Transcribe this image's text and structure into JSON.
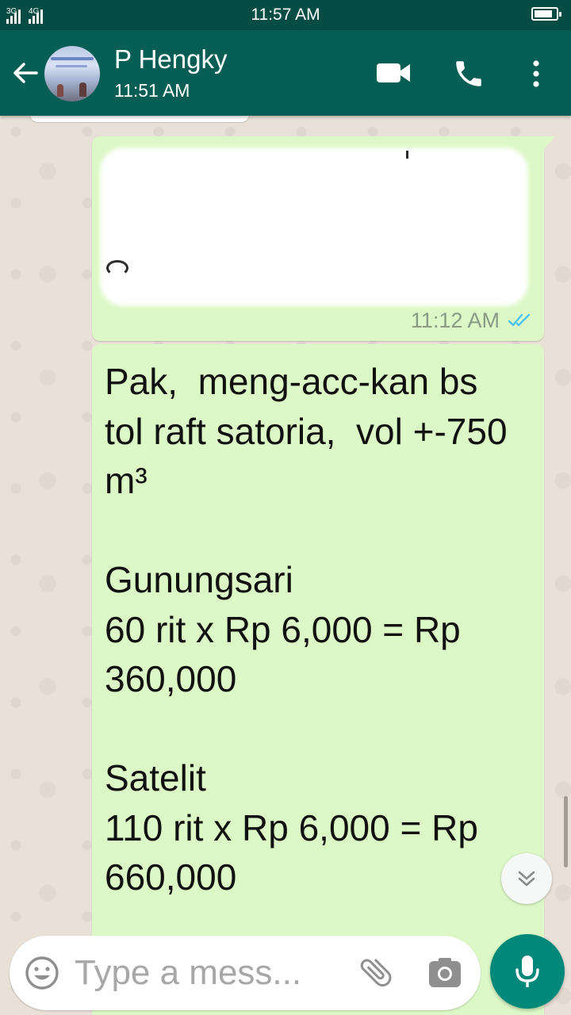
{
  "status_bar": {
    "network_labels": [
      "3G",
      "4G"
    ],
    "time": "11:57 AM",
    "battery_level": 0.85
  },
  "header": {
    "contact_name": "P Hengky",
    "last_seen": "11:51 AM"
  },
  "messages": [
    {
      "direction": "outgoing",
      "content_redacted": true,
      "time": "11:12 AM",
      "status": "read"
    },
    {
      "direction": "outgoing",
      "text": "Pak,  meng-acc-kan bs tol raft satoria,  vol +-750 m³\n\nGunungsari\n60 rit x Rp 6,000 = Rp 360,000\n\nSatelit\n110 rit x Rp 6,000 = Rp 660,000"
    }
  ],
  "input_bar": {
    "placeholder": "Type a mess..."
  },
  "icons": {
    "back": "arrow-left-icon",
    "video": "video-camera-icon",
    "call": "phone-icon",
    "more": "more-vertical-icon",
    "scroll": "chevron-double-down-icon",
    "emoji": "emoji-icon",
    "attach": "paperclip-icon",
    "camera": "camera-icon",
    "mic": "microphone-icon"
  },
  "colors": {
    "header": "#075e54",
    "status_bar": "#054d44",
    "bubble_outgoing": "#dcf8c6",
    "read_ticks": "#4fc3f7",
    "mic_button": "#00897b"
  }
}
